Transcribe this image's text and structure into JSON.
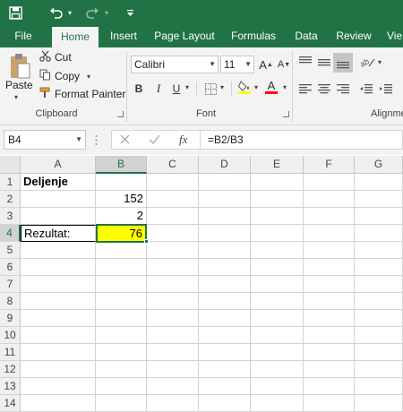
{
  "quick_access": {
    "save_icon": "save-icon",
    "undo_icon": "undo-icon",
    "redo_icon": "redo-icon",
    "customize_icon": "customize-icon"
  },
  "tabs": [
    "File",
    "Home",
    "Insert",
    "Page Layout",
    "Formulas",
    "Data",
    "Review",
    "Vie"
  ],
  "active_tab": "Home",
  "clipboard": {
    "paste": "Paste",
    "cut": "Cut",
    "copy": "Copy",
    "format_painter": "Format Painter",
    "label": "Clipboard"
  },
  "font": {
    "name": "Calibri",
    "size": "11",
    "grow": "A",
    "shrink": "A",
    "bold": "B",
    "italic": "I",
    "underline": "U",
    "font_color_letter": "A",
    "label": "Font"
  },
  "alignment": {
    "label": "Alignme"
  },
  "formula_bar": {
    "name_box": "B4",
    "formula": "=B2/B3",
    "fx": "fx"
  },
  "columns": [
    "A",
    "B",
    "C",
    "D",
    "E",
    "F",
    "G"
  ],
  "rows": [
    "1",
    "2",
    "3",
    "4",
    "5",
    "6",
    "7",
    "8",
    "9",
    "10",
    "11",
    "12",
    "13",
    "14"
  ],
  "cells": {
    "A1": "Deljenje",
    "B2": "152",
    "B3": "2",
    "A4": "Rezultat:",
    "B4": "76"
  },
  "colors": {
    "brand": "#217346",
    "highlight": "#ffff00",
    "font_color_bar": "#ff0000",
    "fill_color_bar": "#ffff00"
  }
}
